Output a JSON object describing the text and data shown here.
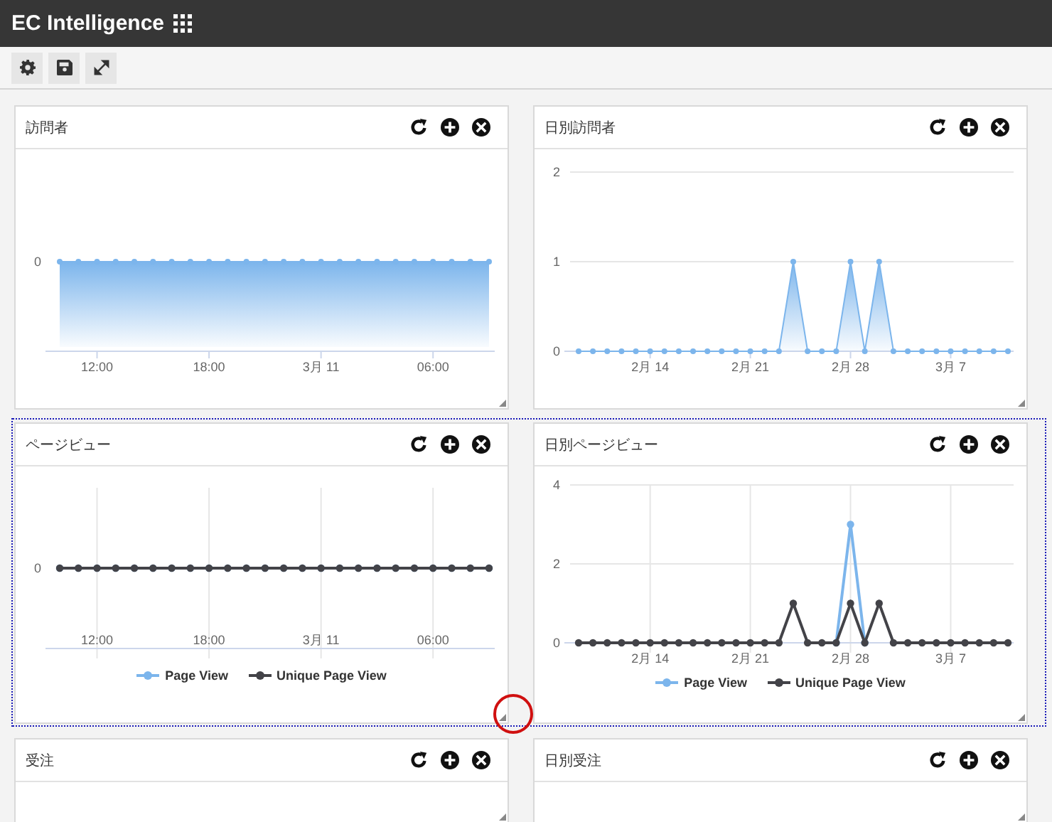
{
  "app": {
    "title": "EC Intelligence"
  },
  "rows": [
    {
      "selected": false,
      "panels": [
        {
          "title": "訪問者",
          "chart": {
            "kind": "area",
            "y_label": "0",
            "x_labels": [
              "12:00",
              "18:00",
              "3月 11",
              "06:00"
            ]
          }
        },
        {
          "title": "日別訪問者",
          "chart_data": {
            "type": "area",
            "grid": true,
            "categories": [
              null,
              null,
              null,
              null,
              null,
              "2月 14",
              null,
              null,
              null,
              null,
              null,
              null,
              "2月 21",
              null,
              null,
              null,
              null,
              null,
              null,
              "2月 28",
              null,
              null,
              null,
              null,
              null,
              null,
              "3月 7",
              null,
              null,
              null,
              null
            ],
            "yticks": [
              0,
              1,
              2
            ],
            "ylim": [
              0,
              2
            ],
            "series": [
              {
                "color": "#7cb5ec",
                "marker": "circle",
                "values": [
                  0,
                  0,
                  0,
                  0,
                  0,
                  0,
                  0,
                  0,
                  0,
                  0,
                  0,
                  0,
                  0,
                  0,
                  0,
                  1,
                  0,
                  0,
                  0,
                  1,
                  0,
                  1,
                  0,
                  0,
                  0,
                  0,
                  0,
                  0,
                  0,
                  0,
                  0
                ]
              }
            ]
          }
        }
      ]
    },
    {
      "selected": true,
      "panels": [
        {
          "title": "ページビュー",
          "chart": {
            "kind": "line",
            "y_label": "0",
            "x_labels": [
              "12:00",
              "18:00",
              "3月 11",
              "06:00"
            ],
            "series": [
              {
                "name": "Page View",
                "color": "#7cb5ec"
              },
              {
                "name": "Unique Page View",
                "color": "#434348"
              }
            ]
          }
        },
        {
          "title": "日別ページビュー",
          "chart_data": {
            "type": "line",
            "grid": true,
            "legend": "bottom",
            "categories": [
              null,
              null,
              null,
              null,
              null,
              "2月 14",
              null,
              null,
              null,
              null,
              null,
              null,
              "2月 21",
              null,
              null,
              null,
              null,
              null,
              null,
              "2月 28",
              null,
              null,
              null,
              null,
              null,
              null,
              "3月 7",
              null,
              null,
              null,
              null
            ],
            "yticks": [
              0,
              2,
              4
            ],
            "ylim": [
              0,
              4
            ],
            "series": [
              {
                "name": "Page View",
                "color": "#7cb5ec",
                "marker": "circle",
                "values": [
                  null,
                  null,
                  null,
                  null,
                  null,
                  null,
                  null,
                  null,
                  null,
                  null,
                  null,
                  null,
                  null,
                  null,
                  null,
                  null,
                  null,
                  null,
                  0,
                  3,
                  0,
                  null,
                  null,
                  null,
                  null,
                  null,
                  null,
                  null,
                  null,
                  null,
                  null
                ]
              },
              {
                "name": "Unique Page View",
                "color": "#434348",
                "marker": "circle",
                "values": [
                  0,
                  0,
                  0,
                  0,
                  0,
                  0,
                  0,
                  0,
                  0,
                  0,
                  0,
                  0,
                  0,
                  0,
                  0,
                  1,
                  0,
                  0,
                  0,
                  1,
                  0,
                  1,
                  0,
                  0,
                  0,
                  0,
                  0,
                  0,
                  0,
                  0,
                  0
                ]
              }
            ]
          }
        }
      ]
    },
    {
      "selected": false,
      "panels": [
        {
          "title": "受注"
        },
        {
          "title": "日別受注"
        }
      ]
    }
  ]
}
